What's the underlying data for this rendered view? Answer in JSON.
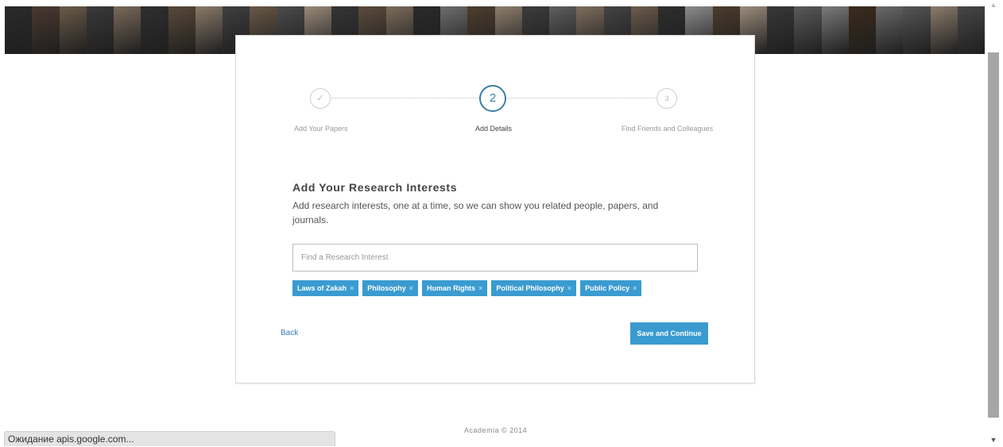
{
  "header": {
    "photo_colors": [
      "#2b2b2b",
      "#4a3a30",
      "#6b5a4a",
      "#3a3a3a",
      "#7a6a5a",
      "#2f2f2f",
      "#5a4a3a",
      "#8a7a6a",
      "#3f3f3f",
      "#6a5848",
      "#4b4b4b",
      "#9a8a7a",
      "#353535",
      "#5c4c3c",
      "#7c6c5c",
      "#2a2a2a",
      "#6e6e6e",
      "#4e3e2e",
      "#8e7e6e",
      "#3c3c3c",
      "#5e5e5e",
      "#7e6e5e",
      "#444444",
      "#6c5c4c",
      "#2e2e2e",
      "#8c8c8c",
      "#4c3c2c",
      "#9c8c7c",
      "#383838",
      "#5a5a5a",
      "#7a7a7a",
      "#3b2b1b",
      "#696969",
      "#555555",
      "#8b7b6b",
      "#474747"
    ]
  },
  "steps": [
    {
      "marker": "✓",
      "label": "Add Your Papers"
    },
    {
      "marker": "2",
      "label": "Add Details"
    },
    {
      "marker": "3",
      "label": "Find Friends and Colleagues"
    }
  ],
  "section": {
    "title": "Add Your Research Interests",
    "description": "Add research interests, one at a time, so we can show you related people, papers, and journals."
  },
  "search": {
    "placeholder": "Find a Research Interest",
    "value": ""
  },
  "tags": [
    {
      "label": "Laws of Zakah",
      "remove": "×"
    },
    {
      "label": "Philosophy",
      "remove": "×"
    },
    {
      "label": "Human Rights",
      "remove": "×"
    },
    {
      "label": "Political Philosophy",
      "remove": "×"
    },
    {
      "label": "Public Policy",
      "remove": "×"
    }
  ],
  "actions": {
    "back_label": "Back",
    "save_label": "Save and Continue"
  },
  "footer": {
    "text": "Academia © 2014"
  },
  "status_bar": {
    "text": "Ожидание apis.google.com..."
  },
  "colors": {
    "accent": "#3a9bd0",
    "step_active": "#3d7ea6",
    "link": "#3a7ab8"
  }
}
